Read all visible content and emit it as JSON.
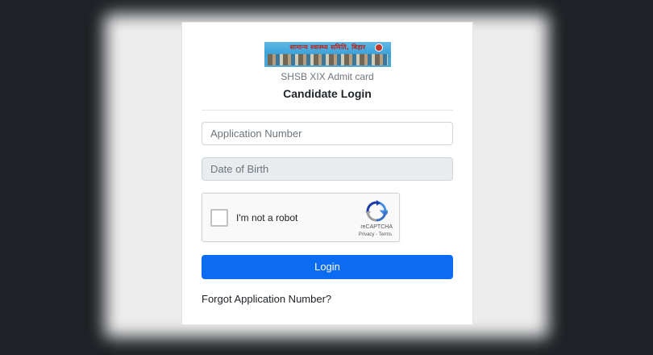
{
  "banner": {
    "text": "सामान्य स्वास्थ्य समिति, बिहार"
  },
  "page": {
    "subtitle": "SHSB XIX Admit card",
    "title": "Candidate Login"
  },
  "form": {
    "application_placeholder": "Application Number",
    "dob_placeholder": "Date of Birth",
    "login_label": "Login",
    "forgot_label": "Forgot Application Number?"
  },
  "recaptcha": {
    "label": "I'm not a robot",
    "brand": "reCAPTCHA",
    "links": "Privacy - Terms"
  },
  "colors": {
    "primary": "#0b6cf2",
    "background": "#202327",
    "disabled_input": "#e9ecef"
  },
  "icons": [
    "recaptcha-logo-icon",
    "checkbox-icon"
  ]
}
